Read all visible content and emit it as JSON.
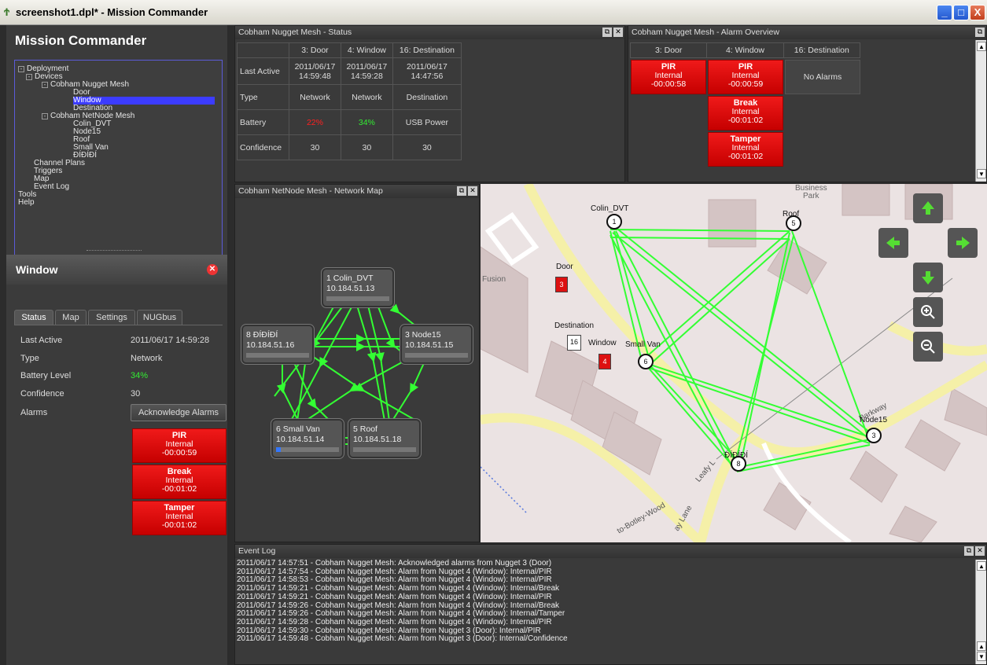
{
  "window": {
    "title": "screenshot1.dpl* - Mission Commander",
    "min": "_",
    "max": "□",
    "close": "X"
  },
  "app": {
    "title": "Mission Commander"
  },
  "tree": [
    {
      "label": "Deployment",
      "toggle": "-"
    },
    {
      "label": "Devices",
      "toggle": "-"
    },
    {
      "label": "Cobham Nugget Mesh",
      "toggle": "-"
    },
    {
      "label": "Door"
    },
    {
      "label": "Window"
    },
    {
      "label": "Destination"
    },
    {
      "label": "Cobham NetNode Mesh",
      "toggle": "-"
    },
    {
      "label": "Colin_DVT"
    },
    {
      "label": "Node15"
    },
    {
      "label": "Roof"
    },
    {
      "label": "Small Van"
    },
    {
      "label": "ÐÍÐÍÐÍ"
    },
    {
      "label": "Channel Plans"
    },
    {
      "label": "Triggers"
    },
    {
      "label": "Map"
    },
    {
      "label": "Event Log"
    },
    {
      "label": "Tools"
    },
    {
      "label": "Help"
    }
  ],
  "device_panel": {
    "title": "Window",
    "tabs": [
      "Status",
      "Map",
      "Settings",
      "NUGbus"
    ],
    "rows": [
      {
        "label": "Last Active",
        "value": "2011/06/17 14:59:28"
      },
      {
        "label": "Type",
        "value": "Network"
      },
      {
        "label": "Battery Level",
        "value": "34%"
      },
      {
        "label": "Confidence",
        "value": "30"
      }
    ],
    "alarms_label": "Alarms",
    "ack_button": "Acknowledge Alarms",
    "alarms": [
      {
        "name": "PIR",
        "source": "Internal",
        "time": "-00:00:59"
      },
      {
        "name": "Break",
        "source": "Internal",
        "time": "-00:01:02"
      },
      {
        "name": "Tamper",
        "source": "Internal",
        "time": "-00:01:02"
      }
    ]
  },
  "status_pane": {
    "title": "Cobham Nugget Mesh - Status",
    "columns": [
      "3: Door",
      "4: Window",
      "16: Destination"
    ],
    "rows": [
      {
        "label": "Last Active",
        "cells": [
          [
            "2011/06/17",
            "14:59:48"
          ],
          [
            "2011/06/17",
            "14:59:28"
          ],
          [
            "2011/06/17",
            "14:47:56"
          ]
        ]
      },
      {
        "label": "Type",
        "cells": [
          [
            "Network"
          ],
          [
            "Network"
          ],
          [
            "Destination"
          ]
        ]
      },
      {
        "label": "Battery",
        "cells": [
          [
            "22%"
          ],
          [
            "34%"
          ],
          [
            "USB Power"
          ]
        ]
      },
      {
        "label": "Confidence",
        "cells": [
          [
            "30"
          ],
          [
            "30"
          ],
          [
            "30"
          ]
        ]
      }
    ],
    "colors": {
      "battery_low": "#ff2020",
      "battery_ok": "#33ee33"
    }
  },
  "alarm_pane": {
    "title": "Cobham Nugget Mesh - Alarm Overview",
    "columns": [
      "3: Door",
      "4: Window",
      "16: Destination"
    ],
    "door": [
      {
        "name": "PIR",
        "source": "Internal",
        "time": "-00:00:58"
      }
    ],
    "window": [
      {
        "name": "PIR",
        "source": "Internal",
        "time": "-00:00:59"
      },
      {
        "name": "Break",
        "source": "Internal",
        "time": "-00:01:02"
      },
      {
        "name": "Tamper",
        "source": "Internal",
        "time": "-00:01:02"
      }
    ],
    "destination_text": "No Alarms"
  },
  "network_pane": {
    "title": "Cobham NetNode Mesh - Network Map",
    "nodes": [
      {
        "id": "1",
        "name": "Colin_DVT",
        "ip": "10.184.51.13",
        "level": 0
      },
      {
        "id": "3",
        "name": "Node15",
        "ip": "10.184.51.15",
        "level": 0
      },
      {
        "id": "5",
        "name": "Roof",
        "ip": "10.184.51.18",
        "level": 0
      },
      {
        "id": "6",
        "name": "Small Van",
        "ip": "10.184.51.14",
        "level": 0.08
      },
      {
        "id": "8",
        "name": "ÐÍÐÍÐÍ",
        "ip": "10.184.51.16",
        "level": 0
      }
    ]
  },
  "map": {
    "labels": {
      "business": "Business",
      "park": "Park",
      "fusion": "Fusion",
      "parkway": "Parkway",
      "leafy": "Leafy L",
      "lane": "ay Lane",
      "botley": "to-Botley-Wood"
    },
    "markers": [
      {
        "name": "Colin_DVT",
        "num": "1"
      },
      {
        "name": "Roof",
        "num": "5"
      },
      {
        "name": "Door",
        "num": "3"
      },
      {
        "name": "Destination",
        "num": "16"
      },
      {
        "name": "Window",
        "num": "4"
      },
      {
        "name": "Small Van",
        "num": "6"
      },
      {
        "name": "Node15",
        "num": "3"
      },
      {
        "name": "ÐÍÐÍÐÍ",
        "num": "8"
      }
    ]
  },
  "event_log": {
    "title": "Event Log",
    "lines": [
      "2011/06/17 14:57:51 - Cobham Nugget Mesh: Acknowledged alarms from Nugget 3 (Door)",
      "2011/06/17 14:57:54 - Cobham Nugget Mesh: Alarm from Nugget 4 (Window): Internal/PIR",
      "2011/06/17 14:58:53 - Cobham Nugget Mesh: Alarm from Nugget 4 (Window): Internal/PIR",
      "2011/06/17 14:59:21 - Cobham Nugget Mesh: Alarm from Nugget 4 (Window): Internal/Break",
      "2011/06/17 14:59:21 - Cobham Nugget Mesh: Alarm from Nugget 4 (Window): Internal/PIR",
      "2011/06/17 14:59:26 - Cobham Nugget Mesh: Alarm from Nugget 4 (Window): Internal/Break",
      "2011/06/17 14:59:26 - Cobham Nugget Mesh: Alarm from Nugget 4 (Window): Internal/Tamper",
      "2011/06/17 14:59:28 - Cobham Nugget Mesh: Alarm from Nugget 4 (Window): Internal/PIR",
      "2011/06/17 14:59:30 - Cobham Nugget Mesh: Alarm from Nugget 3 (Door): Internal/PIR",
      "2011/06/17 14:59:48 - Cobham Nugget Mesh: Alarm from Nugget 3 (Door): Internal/Confidence"
    ]
  },
  "icons": {
    "restore": "restore-icon",
    "close": "close-icon",
    "zoom_in": "zoom-in-icon",
    "zoom_out": "zoom-out-icon",
    "pan": "arrow-icon"
  }
}
